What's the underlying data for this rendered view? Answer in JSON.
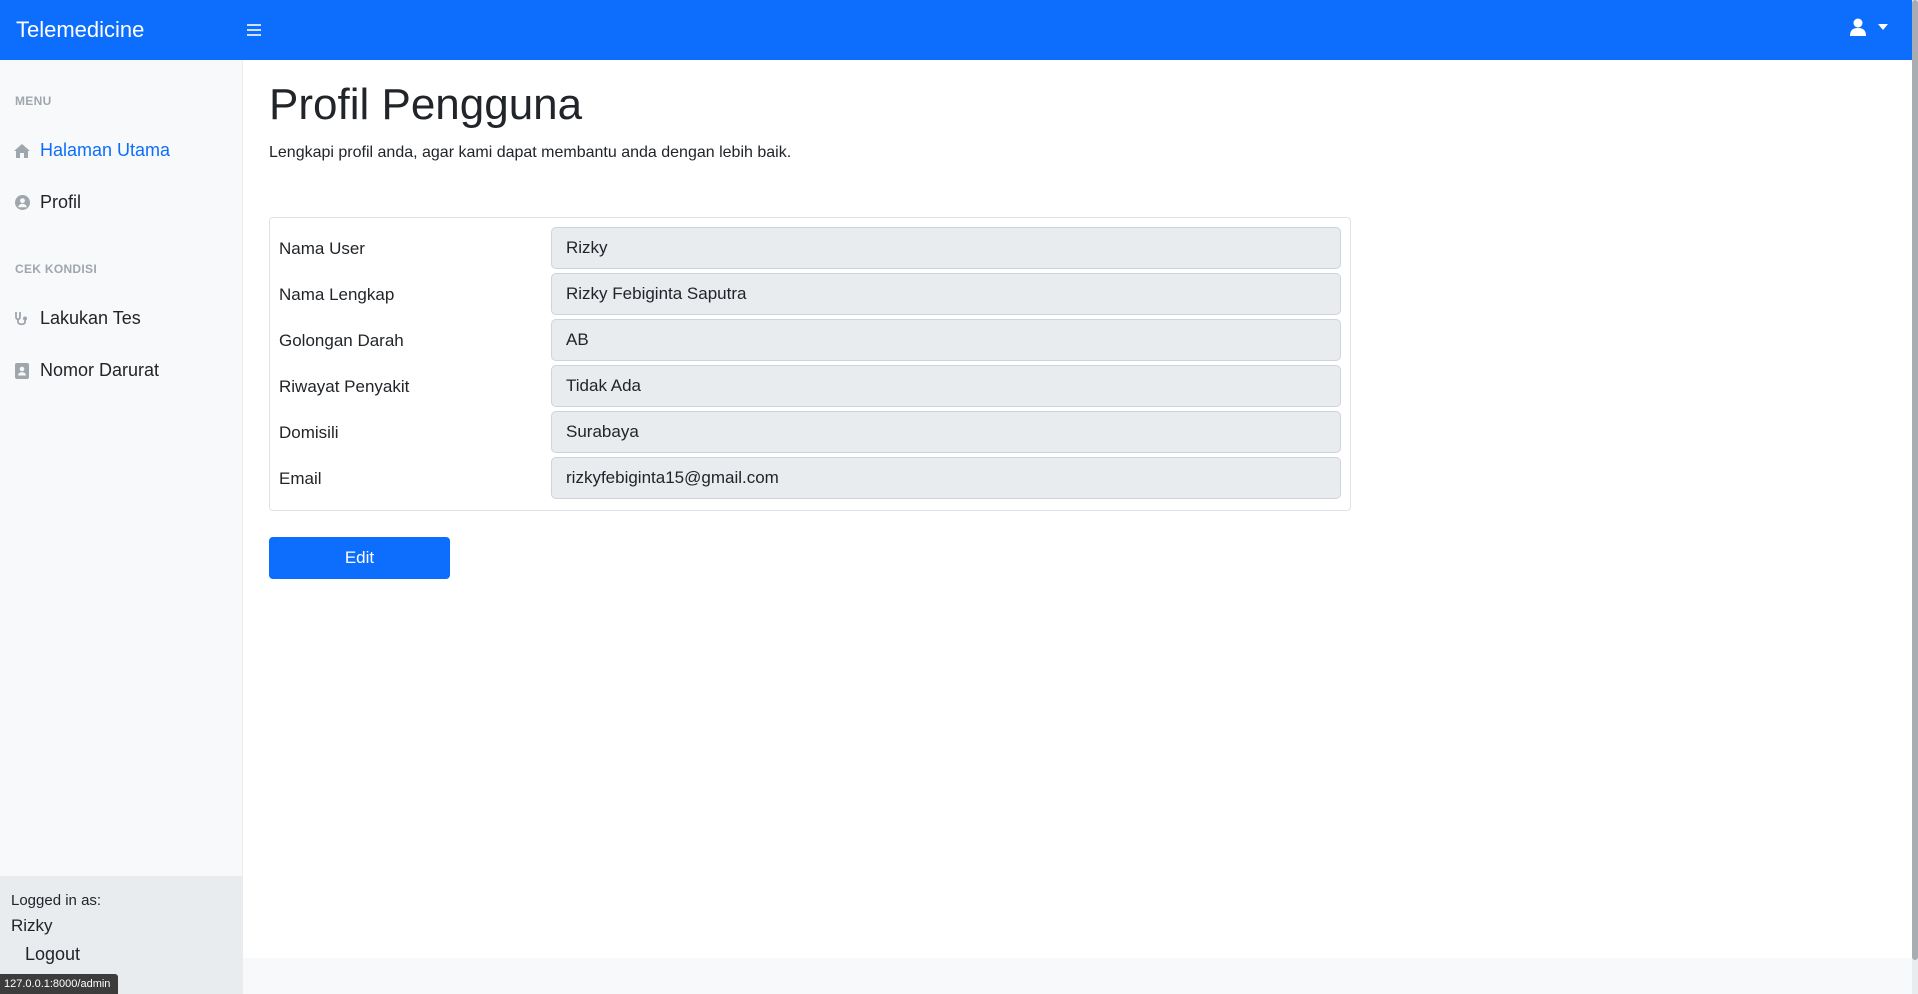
{
  "navbar": {
    "brand": "Telemedicine",
    "toggle_icon": "hamburger-icon",
    "user_icon": "user-icon",
    "dropdown_icon": "caret-down-icon",
    "color": "#0d6efd"
  },
  "sidebar": {
    "sections": [
      {
        "heading": "MENU",
        "items": [
          {
            "label": "Halaman Utama",
            "icon": "home-icon",
            "active": true
          },
          {
            "label": "Profil",
            "icon": "user-circle-icon",
            "active": false
          }
        ]
      },
      {
        "heading": "CEK KONDISI",
        "items": [
          {
            "label": "Lakukan Tes",
            "icon": "stethoscope-icon",
            "active": false
          },
          {
            "label": "Nomor Darurat",
            "icon": "contact-book-icon",
            "active": false
          }
        ]
      }
    ],
    "footer": {
      "logged_in_label": "Logged in as:",
      "username": "Rizky",
      "logout_label": "Logout"
    }
  },
  "main": {
    "title": "Profil Pengguna",
    "subtitle": "Lengkapi profil anda, agar kami dapat membantu anda dengan lebih baik.",
    "profile": [
      {
        "label": "Nama User",
        "value": "Rizky"
      },
      {
        "label": "Nama Lengkap",
        "value": "Rizky Febiginta Saputra"
      },
      {
        "label": "Golongan Darah",
        "value": "AB"
      },
      {
        "label": "Riwayat Penyakit",
        "value": "Tidak Ada"
      },
      {
        "label": "Domisili",
        "value": "Surabaya"
      },
      {
        "label": "Email",
        "value": "rizkyfebiginta15@gmail.com"
      }
    ],
    "edit_label": "Edit"
  },
  "status_bar": {
    "url": "127.0.0.1:8000/admin"
  },
  "colors": {
    "primary": "#0d6efd",
    "sidebar_bg": "#f8f9fa",
    "field_bg": "#e9ecef",
    "heading_muted": "#a0a6ad"
  }
}
